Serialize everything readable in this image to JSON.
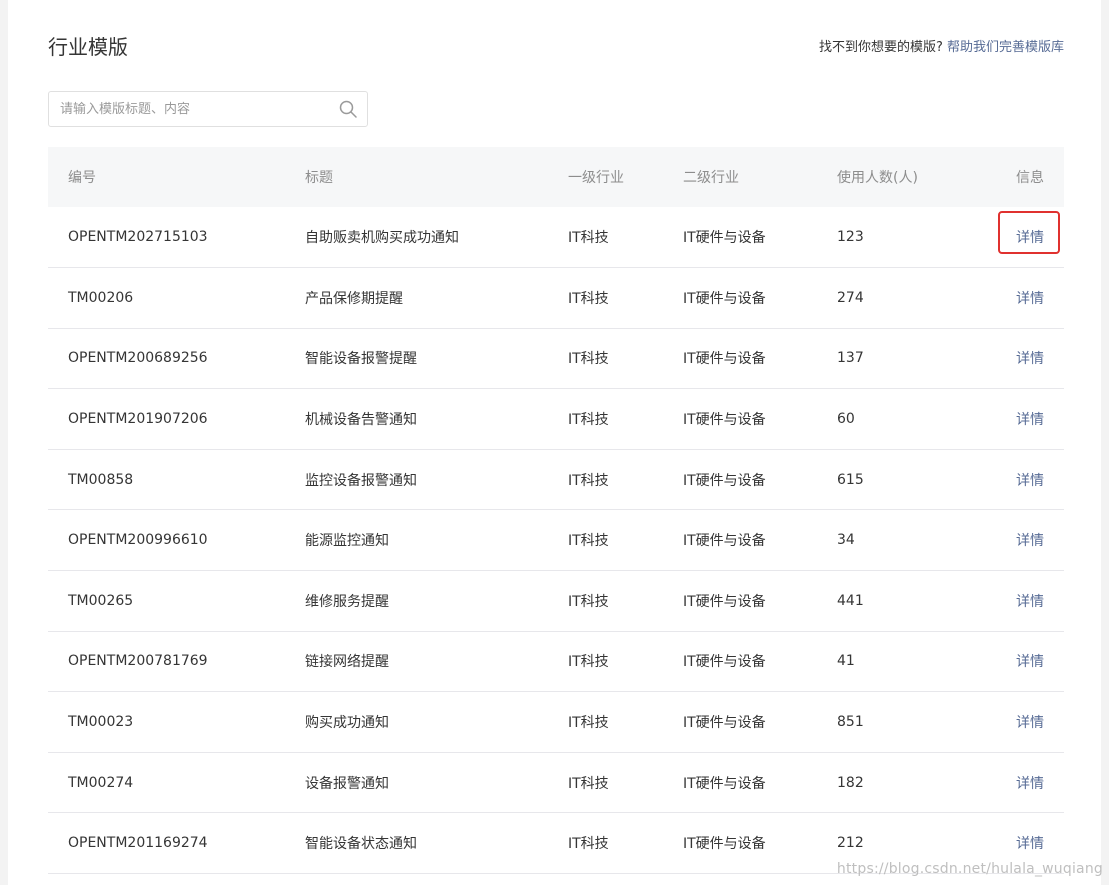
{
  "header": {
    "title": "行业模版",
    "help_text": "找不到你想要的模版?",
    "help_link": "帮助我们完善模版库"
  },
  "search": {
    "placeholder": "请输入模版标题、内容",
    "value": ""
  },
  "table": {
    "columns": [
      "编号",
      "标题",
      "一级行业",
      "二级行业",
      "使用人数(人)",
      "信息"
    ],
    "rows": [
      {
        "id": "OPENTM202715103",
        "title": "自助贩卖机购买成功通知",
        "industry1": "IT科技",
        "industry2": "IT硬件与设备",
        "users": "123",
        "action": "详情"
      },
      {
        "id": "TM00206",
        "title": "产品保修期提醒",
        "industry1": "IT科技",
        "industry2": "IT硬件与设备",
        "users": "274",
        "action": "详情"
      },
      {
        "id": "OPENTM200689256",
        "title": "智能设备报警提醒",
        "industry1": "IT科技",
        "industry2": "IT硬件与设备",
        "users": "137",
        "action": "详情"
      },
      {
        "id": "OPENTM201907206",
        "title": "机械设备告警通知",
        "industry1": "IT科技",
        "industry2": "IT硬件与设备",
        "users": "60",
        "action": "详情"
      },
      {
        "id": "TM00858",
        "title": "监控设备报警通知",
        "industry1": "IT科技",
        "industry2": "IT硬件与设备",
        "users": "615",
        "action": "详情"
      },
      {
        "id": "OPENTM200996610",
        "title": "能源监控通知",
        "industry1": "IT科技",
        "industry2": "IT硬件与设备",
        "users": "34",
        "action": "详情"
      },
      {
        "id": "TM00265",
        "title": "维修服务提醒",
        "industry1": "IT科技",
        "industry2": "IT硬件与设备",
        "users": "441",
        "action": "详情"
      },
      {
        "id": "OPENTM200781769",
        "title": "链接网络提醒",
        "industry1": "IT科技",
        "industry2": "IT硬件与设备",
        "users": "41",
        "action": "详情"
      },
      {
        "id": "TM00023",
        "title": "购买成功通知",
        "industry1": "IT科技",
        "industry2": "IT硬件与设备",
        "users": "851",
        "action": "详情"
      },
      {
        "id": "TM00274",
        "title": "设备报警通知",
        "industry1": "IT科技",
        "industry2": "IT硬件与设备",
        "users": "182",
        "action": "详情"
      },
      {
        "id": "OPENTM201169274",
        "title": "智能设备状态通知",
        "industry1": "IT科技",
        "industry2": "IT硬件与设备",
        "users": "212",
        "action": "详情"
      }
    ]
  },
  "watermark": "https://blog.csdn.net/hulala_wuqiang",
  "colors": {
    "link": "#576b95",
    "highlight": "#e0312f",
    "header_bg": "#f6f7f8"
  }
}
